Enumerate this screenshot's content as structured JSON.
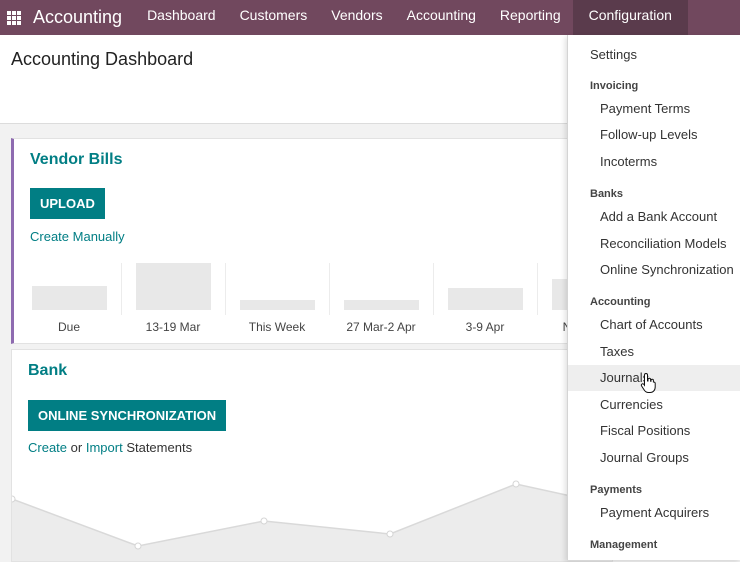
{
  "navbar": {
    "brand": "Accounting",
    "menu": [
      "Dashboard",
      "Customers",
      "Vendors",
      "Accounting",
      "Reporting",
      "Configuration"
    ]
  },
  "page": {
    "title": "Accounting Dashboard"
  },
  "vendor_bills": {
    "title": "Vendor Bills",
    "upload_label": "UPLOAD",
    "create_manually": "Create Manually",
    "bar_labels": [
      "Due",
      "13-19 Mar",
      "This Week",
      "27 Mar-2 Apr",
      "3-9 Apr",
      "N"
    ]
  },
  "bank": {
    "title": "Bank",
    "online_sync_label": "ONLINE SYNCHRONIZATION",
    "create": "Create",
    "or": "or",
    "import": "Import",
    "statements": "Statements"
  },
  "dropdown": {
    "settings": "Settings",
    "invoicing_header": "Invoicing",
    "payment_terms": "Payment Terms",
    "followup_levels": "Follow-up Levels",
    "incoterms": "Incoterms",
    "banks_header": "Banks",
    "add_bank_account": "Add a Bank Account",
    "reconciliation_models": "Reconciliation Models",
    "online_synchronization": "Online Synchronization",
    "accounting_header": "Accounting",
    "chart_of_accounts": "Chart of Accounts",
    "taxes": "Taxes",
    "journals": "Journals",
    "currencies": "Currencies",
    "fiscal_positions": "Fiscal Positions",
    "journal_groups": "Journal Groups",
    "payments_header": "Payments",
    "payment_acquirers": "Payment Acquirers",
    "management_header": "Management"
  },
  "colors": {
    "navbar": "#71485e",
    "primary": "#017e84",
    "vendor_accent": "#8e6bb0"
  }
}
